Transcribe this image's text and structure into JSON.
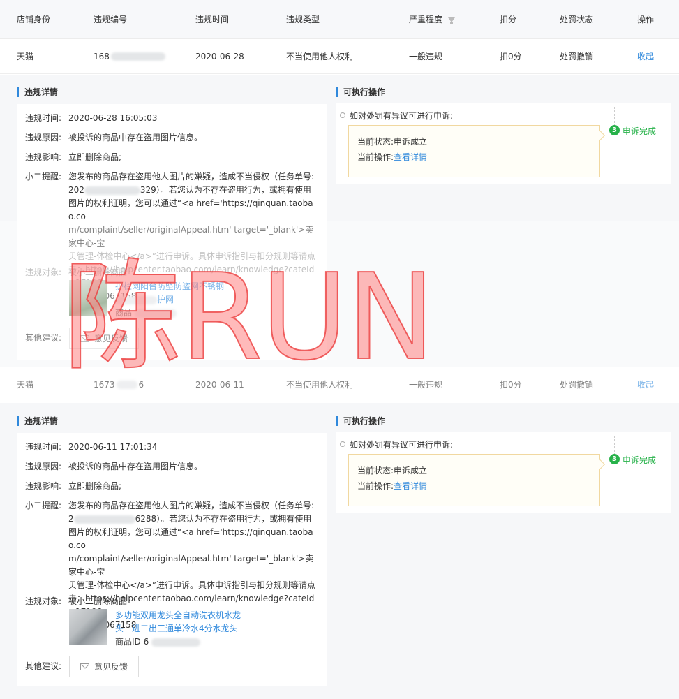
{
  "table": {
    "headers": [
      "店铺身份",
      "违规编号",
      "违规时间",
      "违规类型",
      "严重程度",
      "扣分",
      "处罚状态",
      "操作"
    ],
    "rows": [
      {
        "shop": "天猫",
        "id": "168",
        "time": "2020-06-28",
        "type": "不当使用他人权利",
        "severity": "一般违规",
        "points": "扣0分",
        "status": "处罚撤销",
        "action": "收起"
      },
      {
        "shop": "天猫",
        "id": "1673",
        "id_tail": "6",
        "time": "2020-06-11",
        "type": "不当使用他人权利",
        "severity": "一般违规",
        "points": "扣0分",
        "status": "处罚撤销",
        "action": "收起"
      }
    ]
  },
  "labels": {
    "detail_title": "违规详情",
    "action_title": "可执行操作",
    "time_k": "违规时间:",
    "reason_k": "违规原因:",
    "impact_k": "违规影响:",
    "tip_k": "小二提醒:",
    "target_k": "违规对象:",
    "other_k": "其他建议:",
    "feedback_btn": "意见反馈",
    "appeal_prompt": "如对处罚有异议可进行申诉:",
    "cur_status_k": "当前状态:",
    "cur_op_k": "当前操作:",
    "step_num": "3",
    "step_text": "申诉完成"
  },
  "details": [
    {
      "time": "2020-06-28 16:05:03",
      "reason": "被投诉的商品中存在盗用图片信息。",
      "impact": "立即删除商品;",
      "tip_1": "您发布的商品存在盗用他人图片的嫌疑，造成不当侵权（任务单号:",
      "tip_num_head": "202",
      "tip_num_tail": "329）",
      "tip_2": "。若您认为不存在盗用行为，或拥有使用",
      "tip_3": "图片的权利证明，您可以通过“<a href='https://qinquan.taobao.co",
      "tip_4": "m/complaint/seller/originalAppeal.htm' target='_blank'>卖家中心-宝",
      "tip_5": "贝管理-体检中心</a>”进行申诉。具体申诉指引与扣分规则等请点",
      "tip_6": "击：https://helpcenter.taobao.com/learn/knowledge?cateId=1719&",
      "tip_7": "id=1060067158",
      "target": "被小二删除商品",
      "product_line1": "护栏网阳台防坠防盗网不锈钢",
      "product_line2": "护网",
      "product_id": "商品",
      "status": "申诉成立",
      "op": "查看详情"
    },
    {
      "time": "2020-06-11 17:01:34",
      "reason": "被投诉的商品中存在盗用图片信息。",
      "impact": "立即删除商品;",
      "tip_1": "您发布的商品存在盗用他人图片的嫌疑，造成不当侵权（任务单号:",
      "tip_num_head": "2",
      "tip_num_tail": "6288）",
      "tip_2": "。若您认为不存在盗用行为，或拥有使用",
      "tip_3": "图片的权利证明，您可以通过“<a href='https://qinquan.taobao.co",
      "tip_4": "m/complaint/seller/originalAppeal.htm' target='_blank'>卖家中心-宝",
      "tip_5": "贝管理-体检中心</a>”进行申诉。具体申诉指引与扣分规则等请点",
      "tip_6": "击：https://helpcenter.taobao.com/learn/knowledge?cateId=1719&",
      "tip_7": "id=1060067158",
      "target": "被小二删除商品",
      "product_line1": "多功能双用龙头全自动洗衣机水龙",
      "product_line2": "头一进二出三通单冷水4分水龙头",
      "product_id": "商品ID 6",
      "status": "申诉成立",
      "op": "查看详情"
    }
  ],
  "watermark": "陈RUN",
  "colors": {
    "link": "#3089dc",
    "success": "#27b24a",
    "accent": "#3089dc",
    "watermark": "#f28b8b"
  }
}
